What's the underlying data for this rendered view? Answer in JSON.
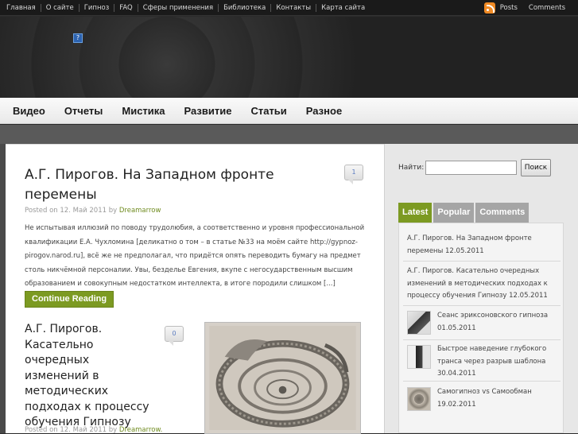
{
  "topnav": {
    "items": [
      "Главная",
      "О сайте",
      "Гипноз",
      "FAQ",
      "Сферы применения",
      "Библиотека",
      "Контакты",
      "Карта сайта"
    ]
  },
  "feeds": {
    "posts": "Posts",
    "comments": "Comments"
  },
  "header": {
    "broken_image_glyph": "?"
  },
  "mainnav": {
    "items": [
      "Видео",
      "Отчеты",
      "Мистика",
      "Развитие",
      "Статьи",
      "Разное"
    ]
  },
  "post1": {
    "title_line1": "А.Г. Пирогов. На Западном фронте",
    "title_line2": "перемены",
    "meta_prefix": "Posted on 12. Май 2011 by ",
    "author": "Dreamarrow",
    "comments": "1",
    "excerpt": "Не испытывая иллюзий по поводу трудолюбия, а соответственно и уровня профессиональной квалификации Е.А. Чухломина [деликатно о том – в статье №33 на моём сайте http://gypnoz-pirogov.narod.ru], всё же не предполагал, что придётся опять переводить бумагу на предмет столь никчёмной персоналии. Увы, безделье Евгения, вкупе с негосударственным высшим образованием и совокупным недостатком интеллекта, в итоге породили слишком [...]",
    "read_more": "Continue Reading"
  },
  "post2": {
    "title_lines": [
      "А.Г. Пирогов.",
      "Касательно",
      "очередных",
      "изменений в",
      "методических",
      "подходах к процессу",
      "обучения Гипнозу"
    ],
    "meta_prefix": "Posted on 12. Май 2011 by ",
    "author": "Dreamarrow.",
    "comments": "0"
  },
  "sidebar": {
    "search_label": "Найти:",
    "search_value": "",
    "search_button": "Поиск",
    "tabs": [
      "Latest",
      "Popular",
      "Comments"
    ],
    "latest": [
      "А.Г. Пирогов. На Западном фронте перемены 12.05.2011",
      "А.Г. Пирогов. Касательно очередных изменений в методических подходах к процессу обучения Гипнозу 12.05.2011"
    ],
    "thumb_items": [
      "Сеанс эриксоновского гипноза 01.05.2011",
      "Быстрое наведение глубокого транса через разрыв шаблона 30.04.2011",
      "Самогипноз vs Самообман 19.02.2011"
    ]
  },
  "colors": {
    "accent": "#7c9a22",
    "tab_inactive": "#a5a5a5",
    "rss": "#f08a24"
  }
}
